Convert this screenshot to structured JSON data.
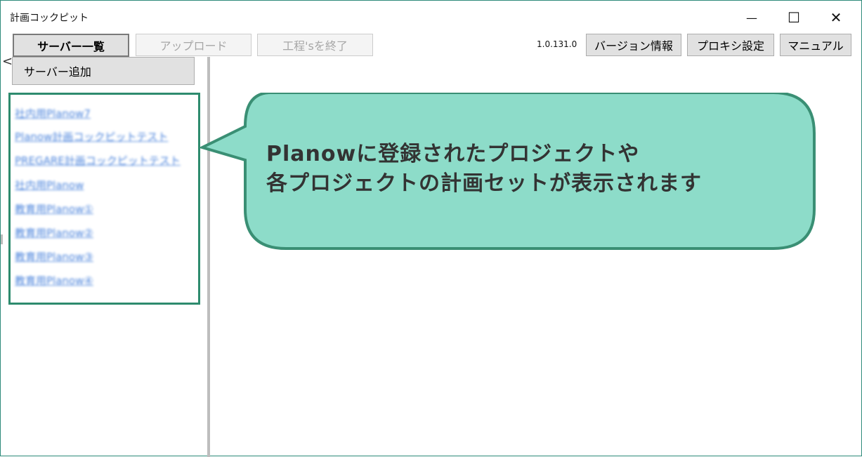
{
  "window": {
    "title": "計画コックピット",
    "controls": {
      "minimize": "—",
      "maximize": "☐",
      "close": "✕"
    }
  },
  "toolbar": {
    "server_list": "サーバー一覧",
    "upload": "アップロード",
    "end_process": "工程'sを終了",
    "version": "1.0.131.0",
    "version_info": "バージョン情報",
    "proxy_settings": "プロキシ設定",
    "manual": "マニュアル"
  },
  "sidebar": {
    "back_icon": "chevron-left-icon",
    "back_glyph": "<",
    "add_server": "サーバー追加",
    "servers": [
      "社内用Planow7",
      "Planow計画コックピットテスト",
      "PREGARE計画コックピットテスト",
      "社内用Planow",
      "教育用Planow①",
      "教育用Planow②",
      "教育用Planow③",
      "教育用Planow④"
    ]
  },
  "callout": {
    "line1": "Planowに登録されたプロジェクトや",
    "line2": "各プロジェクトの計画セットが表示されます",
    "fill_color": "#8ddcc9",
    "border_color": "#3a8f74"
  }
}
